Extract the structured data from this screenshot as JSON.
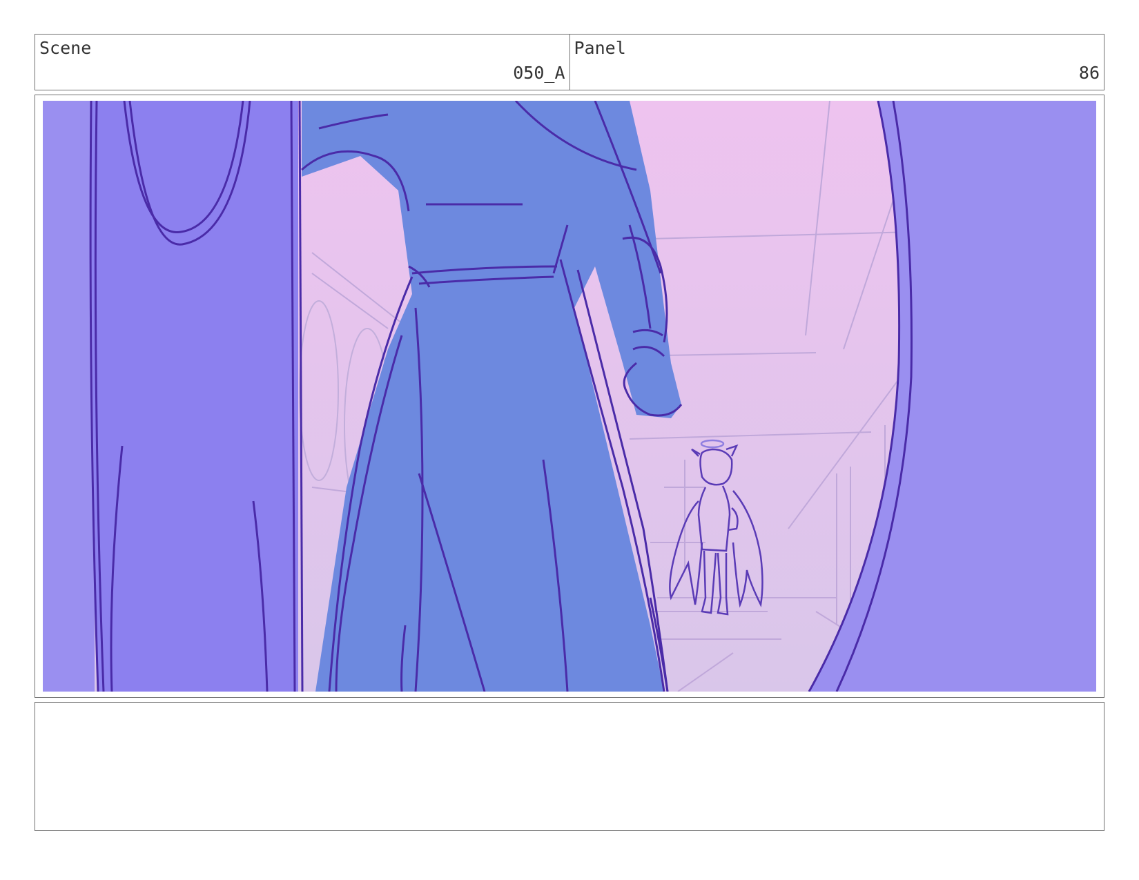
{
  "header": {
    "scene": {
      "label": "Scene",
      "value": "050_A"
    },
    "panel": {
      "label": "Panel",
      "value": "86"
    }
  },
  "colors": {
    "sky_top": "#eec3ef",
    "sky_bottom": "#dcc3ea",
    "robe_fill": "#6d89df",
    "door_fill": "#8c80ef",
    "line_dark": "#4a2ba8",
    "line_light": "#b9a4d8"
  }
}
